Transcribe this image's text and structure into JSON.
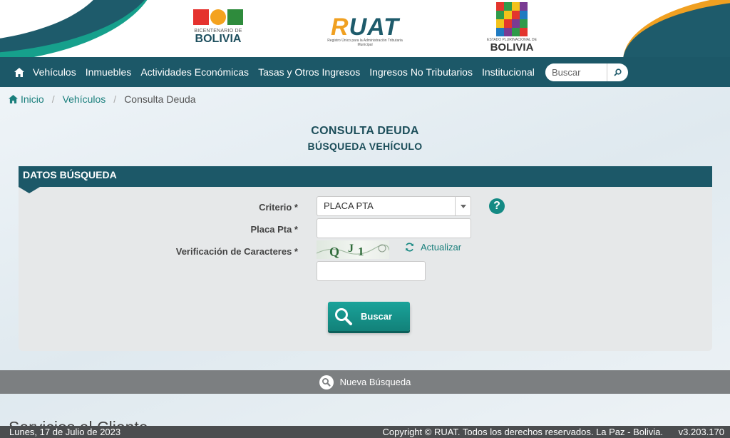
{
  "header": {
    "bicentenario": {
      "small": "BICENTENARIO DE",
      "big": "BOLIVIA"
    },
    "ruat": {
      "name": "RUAT",
      "subtitle": "Registro Único para la Administración Tributaria Municipal"
    },
    "estado": {
      "small": "ESTADO PLURINACIONAL DE",
      "big": "BOLIVIA"
    }
  },
  "nav": {
    "items": [
      {
        "label": "Vehículos"
      },
      {
        "label": "Inmuebles"
      },
      {
        "label": "Actividades Económicas"
      },
      {
        "label": "Tasas y Otros Ingresos"
      },
      {
        "label": "Ingresos No Tributarios"
      },
      {
        "label": "Institucional"
      }
    ],
    "search_placeholder": "Buscar"
  },
  "breadcrumb": {
    "home": "Inicio",
    "section": "Vehículos",
    "current": "Consulta Deuda"
  },
  "page": {
    "title": "CONSULTA DEUDA",
    "subtitle": "BÚSQUEDA VEHÍCULO"
  },
  "panel": {
    "header": "DATOS BÚSQUEDA",
    "criterio_label": "Criterio *",
    "criterio_value": "PLACA PTA",
    "placa_label": "Placa Pta *",
    "verificacion_label": "Verificación de Caracteres *",
    "actualizar_label": "Actualizar",
    "buscar_label": "Buscar"
  },
  "nueva_busqueda": "Nueva Búsqueda",
  "servicios": "Servicios al Cliente",
  "footer": {
    "date": "Lunes, 17 de Julio de 2023",
    "copyright": "Copyright © RUAT. Todos los derechos reservados. La Paz - Bolivia.",
    "version": "v3.203.170"
  },
  "colors": {
    "nav": "#1c5868",
    "accent": "#148a84",
    "orange": "#f0a021",
    "panel": "#e6e8e9"
  }
}
